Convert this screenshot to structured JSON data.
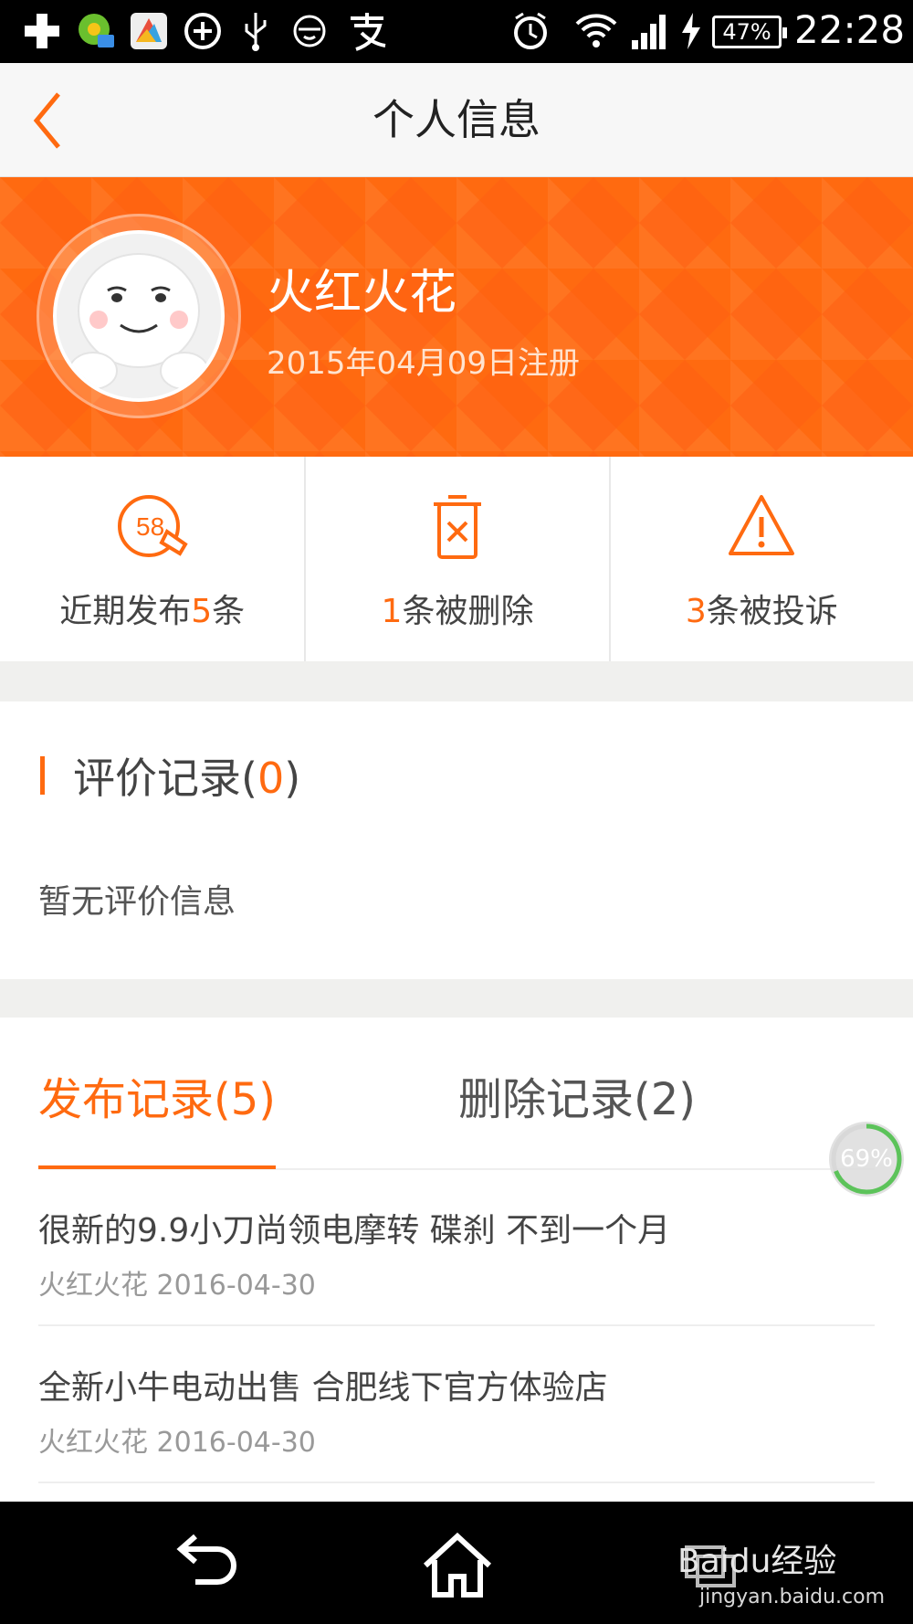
{
  "status_bar": {
    "time": "22:28",
    "battery": "47%"
  },
  "header": {
    "title": "个人信息"
  },
  "profile": {
    "name": "火红火花",
    "registered": "2015年04月09日注册"
  },
  "stats": [
    {
      "icon": "58-edit-icon",
      "before": "近期发布",
      "number": "5",
      "after": "条"
    },
    {
      "icon": "trash-icon",
      "before": "",
      "number": "1",
      "after": "条被删除"
    },
    {
      "icon": "warning-icon",
      "before": "",
      "number": "3",
      "after": "条被投诉"
    }
  ],
  "reviews": {
    "title_prefix": "评价记录(",
    "count": "0",
    "title_suffix": ")",
    "empty_text": "暂无评价信息"
  },
  "records": {
    "tab_published": "发布记录(5)",
    "tab_deleted": "删除记录(2)",
    "items": [
      {
        "title": "很新的9.9小刀尚领电摩转 碟刹 不到一个月",
        "meta": "火红火花 2016-04-30"
      },
      {
        "title": "全新小牛电动出售 合肥线下官方体验店",
        "meta": "火红火花 2016-04-30"
      }
    ]
  },
  "progress_badge": "69%",
  "watermark": {
    "brand": "Baidu经验",
    "url": "jingyan.baidu.com"
  },
  "colors": {
    "accent": "#ff6a10",
    "banner": "#ff6a10"
  }
}
